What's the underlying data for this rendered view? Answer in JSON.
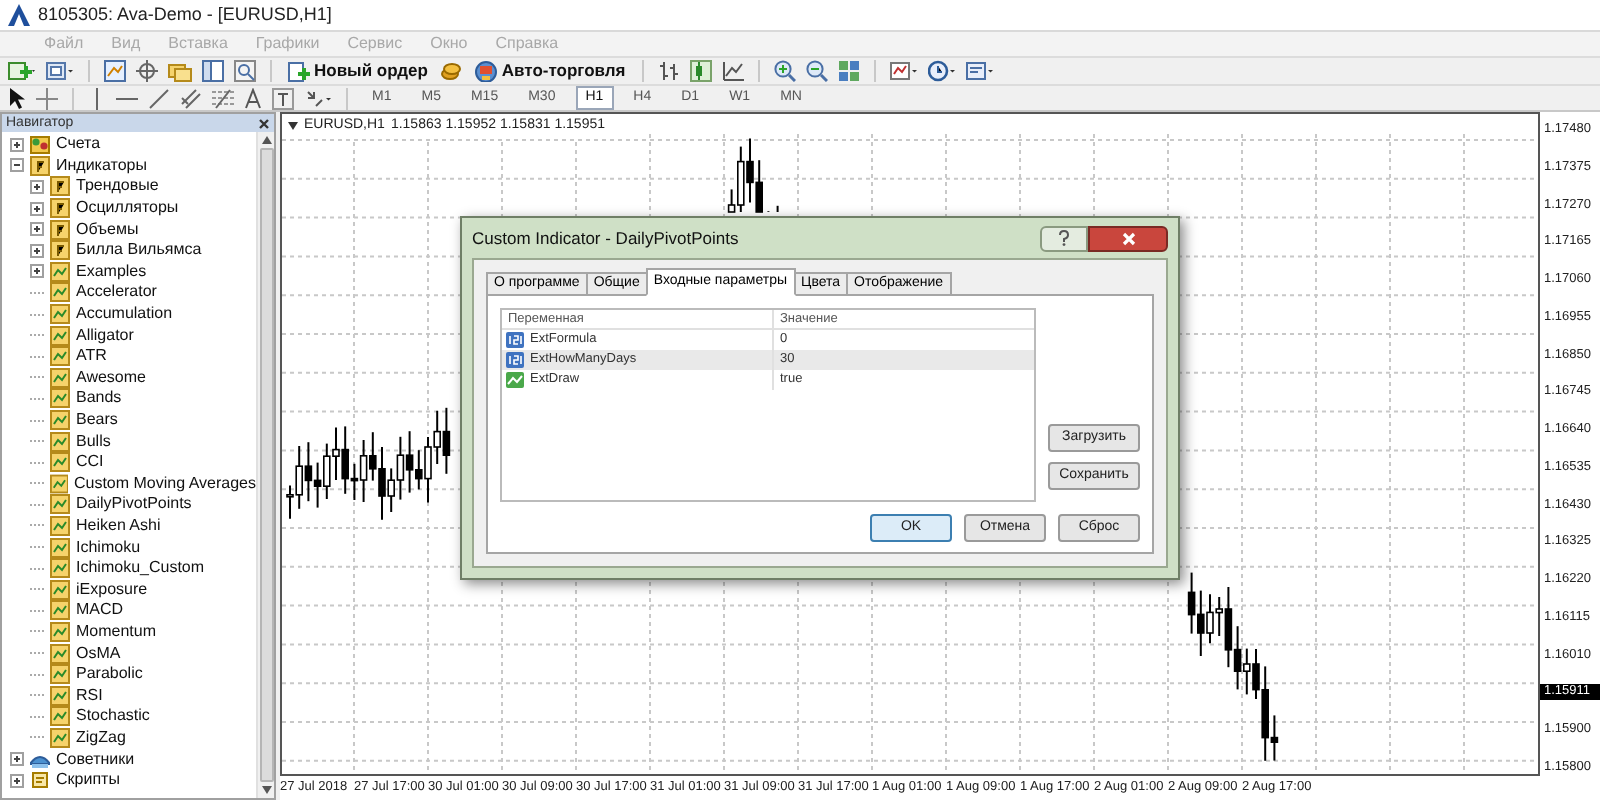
{
  "window": {
    "title": "8105305: Ava-Demo - [EURUSD,H1]"
  },
  "menu": [
    {
      "label": "Файл",
      "disabled": true
    },
    {
      "label": "Вид",
      "disabled": true
    },
    {
      "label": "Вставка",
      "disabled": true
    },
    {
      "label": "Графики",
      "disabled": true
    },
    {
      "label": "Сервис",
      "disabled": true
    },
    {
      "label": "Окно",
      "disabled": true
    },
    {
      "label": "Справка",
      "disabled": true
    }
  ],
  "toolbar": {
    "new_order": "Новый ордер",
    "autotrading": "Авто-торговля"
  },
  "timeframes": [
    {
      "label": "M1",
      "selected": false
    },
    {
      "label": "M5",
      "selected": false
    },
    {
      "label": "M15",
      "selected": false
    },
    {
      "label": "M30",
      "selected": false
    },
    {
      "label": "H1",
      "selected": true
    },
    {
      "label": "H4",
      "selected": false
    },
    {
      "label": "D1",
      "selected": false
    },
    {
      "label": "W1",
      "selected": false
    },
    {
      "label": "MN",
      "selected": false
    }
  ],
  "navigator": {
    "title": "Навигатор",
    "tree": [
      {
        "label": "Счета",
        "kind": "account",
        "expanded": false
      },
      {
        "label": "Индикаторы",
        "kind": "folder",
        "expanded": true,
        "children": [
          {
            "label": "Трендовые",
            "kind": "folder",
            "expanded": false
          },
          {
            "label": "Осцилляторы",
            "kind": "folder",
            "expanded": false
          },
          {
            "label": "Объемы",
            "kind": "folder",
            "expanded": false
          },
          {
            "label": "Билла Вильямса",
            "kind": "folder",
            "expanded": false
          },
          {
            "label": "Examples",
            "kind": "indicator",
            "expanded": false
          },
          {
            "label": "Accelerator",
            "kind": "indicator"
          },
          {
            "label": "Accumulation",
            "kind": "indicator"
          },
          {
            "label": "Alligator",
            "kind": "indicator"
          },
          {
            "label": "ATR",
            "kind": "indicator"
          },
          {
            "label": "Awesome",
            "kind": "indicator"
          },
          {
            "label": "Bands",
            "kind": "indicator"
          },
          {
            "label": "Bears",
            "kind": "indicator"
          },
          {
            "label": "Bulls",
            "kind": "indicator"
          },
          {
            "label": "CCI",
            "kind": "indicator"
          },
          {
            "label": "Custom Moving Averages",
            "kind": "indicator"
          },
          {
            "label": "DailyPivotPoints",
            "kind": "indicator"
          },
          {
            "label": "Heiken Ashi",
            "kind": "indicator"
          },
          {
            "label": "Ichimoku",
            "kind": "indicator"
          },
          {
            "label": "Ichimoku_Custom",
            "kind": "indicator"
          },
          {
            "label": "iExposure",
            "kind": "indicator"
          },
          {
            "label": "MACD",
            "kind": "indicator"
          },
          {
            "label": "Momentum",
            "kind": "indicator"
          },
          {
            "label": "OsMA",
            "kind": "indicator"
          },
          {
            "label": "Parabolic",
            "kind": "indicator"
          },
          {
            "label": "RSI",
            "kind": "indicator"
          },
          {
            "label": "Stochastic",
            "kind": "indicator"
          },
          {
            "label": "ZigZag",
            "kind": "indicator"
          }
        ]
      },
      {
        "label": "Советники",
        "kind": "experts",
        "expanded": false
      },
      {
        "label": "Скрипты",
        "kind": "scripts",
        "expanded": false
      }
    ]
  },
  "chart": {
    "symbol": "EURUSD,H1",
    "quotes": "1.15863 1.15952 1.15831 1.15951",
    "price_labels": [
      "1.17480",
      "1.17375",
      "1.17270",
      "1.17165",
      "1.17060",
      "1.16955",
      "1.16850",
      "1.16745",
      "1.16640",
      "1.16535",
      "1.16430",
      "1.16325",
      "1.16220",
      "1.16115",
      "1.16010"
    ],
    "current_price": "1.15911",
    "lower_price_labels": [
      "1.15900",
      "1.15800"
    ],
    "time_labels": [
      "27 Jul 2018",
      "27 Jul 17:00",
      "30 Jul 01:00",
      "30 Jul 09:00",
      "30 Jul 17:00",
      "31 Jul 01:00",
      "31 Jul 09:00",
      "31 Jul 17:00",
      "1 Aug 01:00",
      "1 Aug 09:00",
      "1 Aug 17:00",
      "2 Aug 01:00",
      "2 Aug 09:00",
      "2 Aug 17:00"
    ]
  },
  "dialog": {
    "title": "Custom Indicator - DailyPivotPoints",
    "tabs": [
      {
        "label": "О программе",
        "selected": false
      },
      {
        "label": "Общие",
        "selected": false
      },
      {
        "label": "Входные параметры",
        "selected": true
      },
      {
        "label": "Цвета",
        "selected": false
      },
      {
        "label": "Отображение",
        "selected": false
      }
    ],
    "columns": [
      "Переменная",
      "Значение"
    ],
    "rows": [
      {
        "kind": "number",
        "name": "ExtFormula",
        "value": "0",
        "selected": false
      },
      {
        "kind": "number",
        "name": "ExtHowManyDays",
        "value": "30",
        "selected": true
      },
      {
        "kind": "boolean",
        "name": "ExtDraw",
        "value": "true",
        "selected": false
      }
    ],
    "side_buttons": [
      "Загрузить",
      "Сохранить"
    ],
    "buttons": [
      {
        "label": "OK",
        "default": true
      },
      {
        "label": "Отмена",
        "default": false
      },
      {
        "label": "Сброс",
        "default": false
      }
    ]
  }
}
